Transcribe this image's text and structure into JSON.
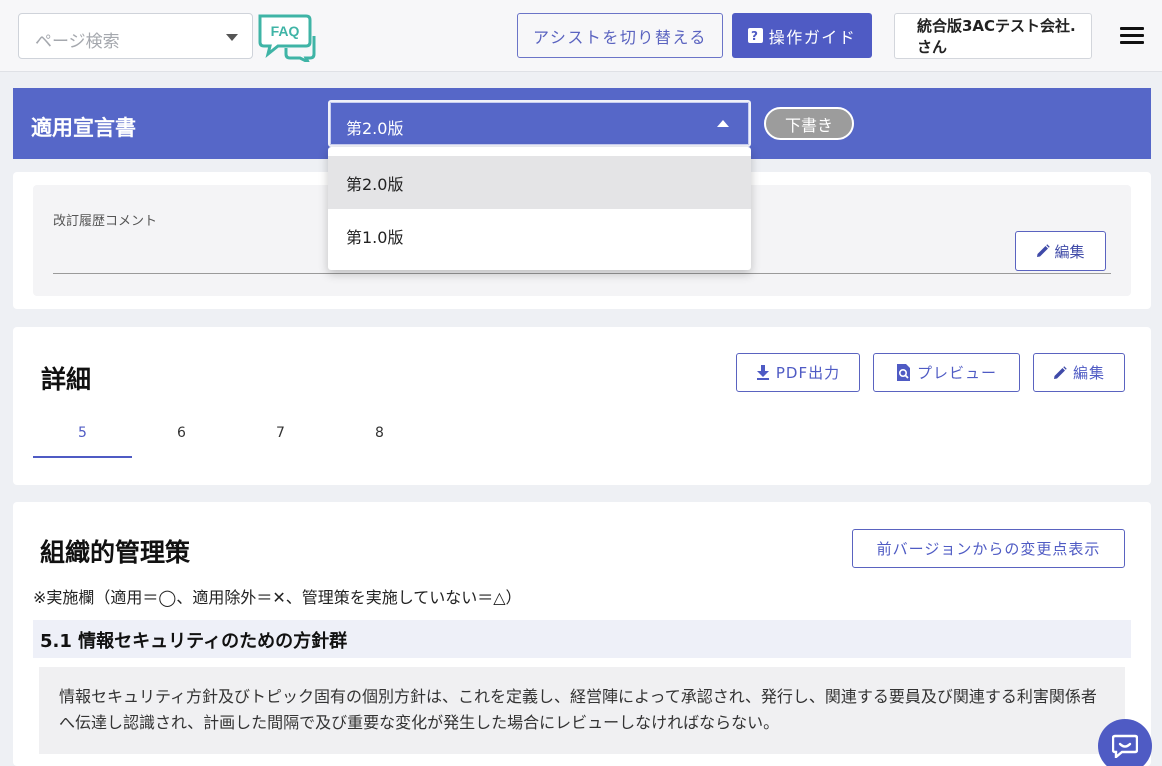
{
  "header": {
    "search_placeholder": "ページ検索",
    "faq_label": "FAQ",
    "assist_button": "アシストを切り替える",
    "guide_button": "操作ガイド",
    "user_name": "統合版3ACテスト会社.さん"
  },
  "titlebar": {
    "title": "適用宣言書",
    "selected_version": "第2.0版",
    "status_badge": "下書き"
  },
  "version_dropdown": {
    "options": [
      "第2.0版",
      "第1.0版"
    ]
  },
  "revision": {
    "label": "改訂履歴コメント",
    "edit_button": "編集"
  },
  "details": {
    "heading": "詳細",
    "pdf_button": "PDF出力",
    "preview_button": "プレビュー",
    "edit_button": "編集",
    "tabs": [
      "5",
      "6",
      "7",
      "8"
    ],
    "active_tab": "5"
  },
  "org_controls": {
    "heading": "組織的管理策",
    "diff_button": "前バージョンからの変更点表示",
    "note": "※実施欄（適用＝◯、適用除外＝✕、管理策を実施していない＝△）",
    "section_title": "5.1 情報セキュリティのための方針群",
    "description": "情報セキュリティ方針及びトピック固有の個別方針は、これを定義し、経営陣によって承認され、発行し、関連する要員及び関連する利害関係者へ伝達し認識され、計画した間隔で及び重要な変化が発生した場合にレビューしなければならない。"
  },
  "colors": {
    "primary": "#4f5bc4",
    "titlebar_bg": "#5667c8",
    "faq_icon": "#3fb4a6",
    "draft_badge": "#9c9c9c"
  },
  "icons": {
    "faq": "faq-speech-bubbles-icon",
    "guide": "question-icon",
    "menu": "hamburger-menu-icon",
    "edit": "pencil-icon",
    "pdf": "download-icon",
    "preview": "document-search-icon",
    "chat": "chat-bubble-icon"
  }
}
